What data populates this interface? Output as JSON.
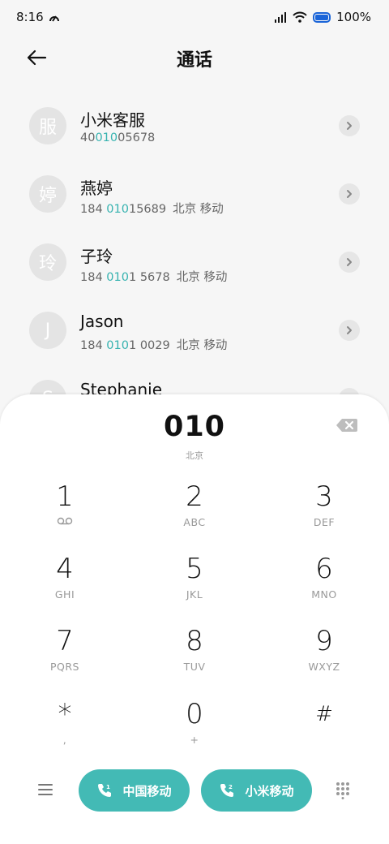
{
  "status_bar": {
    "time": "8:16",
    "battery": "100%"
  },
  "header": {
    "title": "通话"
  },
  "contacts": [
    {
      "avatar": "服",
      "name": "小米客服",
      "pre": "40",
      "match": "010",
      "post": "05678",
      "location": ""
    },
    {
      "avatar": "婷",
      "name": "燕婷",
      "pre": "184 ",
      "match": "010",
      "post": "15689",
      "location": "北京 移动"
    },
    {
      "avatar": "玲",
      "name": "子玲",
      "pre": "184 ",
      "match": "010",
      "post": "1 5678",
      "location": "北京 移动"
    },
    {
      "avatar": "J",
      "name": "Jason",
      "pre": "184 ",
      "match": "010",
      "post": "1 0029",
      "location": "北京 移动"
    },
    {
      "avatar": "S",
      "name": "Stephanie",
      "pre": "",
      "match": "",
      "post": "",
      "location": ""
    }
  ],
  "dialer": {
    "number": "010",
    "location": "北京"
  },
  "keypad": [
    {
      "digit": "1",
      "letters": ""
    },
    {
      "digit": "2",
      "letters": "ABC"
    },
    {
      "digit": "3",
      "letters": "DEF"
    },
    {
      "digit": "4",
      "letters": "GHI"
    },
    {
      "digit": "5",
      "letters": "JKL"
    },
    {
      "digit": "6",
      "letters": "MNO"
    },
    {
      "digit": "7",
      "letters": "PQRS"
    },
    {
      "digit": "8",
      "letters": "TUV"
    },
    {
      "digit": "9",
      "letters": "WXYZ"
    },
    {
      "digit": "*",
      "letters": ","
    },
    {
      "digit": "0",
      "letters": "+"
    },
    {
      "digit": "#",
      "letters": ""
    }
  ],
  "call_buttons": {
    "sim1": "中国移动",
    "sim2": "小米移动"
  },
  "colors": {
    "accent": "#43bab5",
    "highlight": "#37b3b0",
    "battery": "#1a64d8"
  },
  "icons": {
    "voicemail": "voicemail-icon",
    "backspace": "backspace-icon",
    "back": "arrow-left-icon",
    "menu": "hamburger-menu-icon",
    "keypad_toggle": "dialpad-icon"
  }
}
